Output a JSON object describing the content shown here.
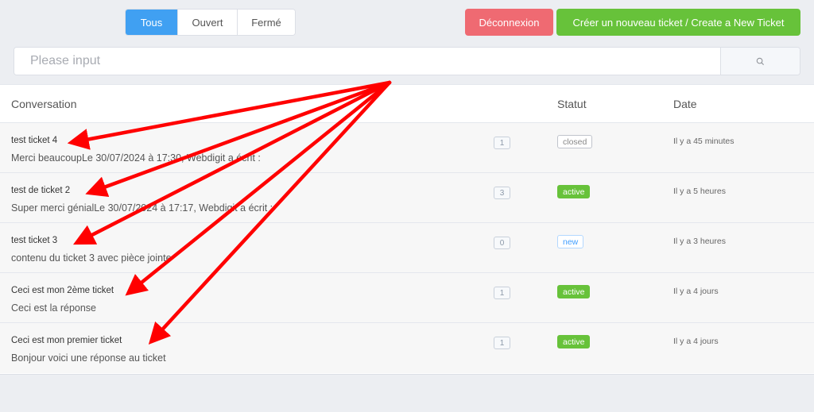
{
  "filters": [
    {
      "label": "Tous",
      "active": true
    },
    {
      "label": "Ouvert",
      "active": false
    },
    {
      "label": "Fermé",
      "active": false
    }
  ],
  "buttons": {
    "logout": "Déconnexion",
    "new_ticket": "Créer un nouveau ticket / Create a New Ticket"
  },
  "search": {
    "placeholder": "Please input",
    "button_icon": "search-icon"
  },
  "table": {
    "headers": {
      "conversation": "Conversation",
      "status": "Statut",
      "date": "Date"
    },
    "rows": [
      {
        "title": "test ticket 4",
        "snippet": "Merci beaucoupLe 30/07/2024 à 17:30, Webdigit a écrit :",
        "count": "1",
        "status": "closed",
        "date": "Il y a 45 minutes"
      },
      {
        "title": "test de ticket 2",
        "snippet": "Super merci génialLe 30/07/2024 à 17:17, Webdigit a écrit :",
        "count": "3",
        "status": "active",
        "date": "Il y a 5 heures"
      },
      {
        "title": "test ticket 3",
        "snippet": "contenu du ticket 3 avec pièce jointe",
        "count": "0",
        "status": "new",
        "date": "Il y a 3 heures"
      },
      {
        "title": "Ceci est mon 2ème ticket",
        "snippet": "Ceci est la réponse",
        "count": "1",
        "status": "active",
        "date": "Il y a 4 jours"
      },
      {
        "title": "Ceci est mon premier ticket",
        "snippet": "Bonjour voici une réponse au ticket",
        "count": "1",
        "status": "active",
        "date": "Il y a 4 jours"
      }
    ]
  },
  "colors": {
    "primary": "#40a0f2",
    "danger": "#ef6a72",
    "success": "#67c23a",
    "annotation_arrow": "#ff0000"
  }
}
